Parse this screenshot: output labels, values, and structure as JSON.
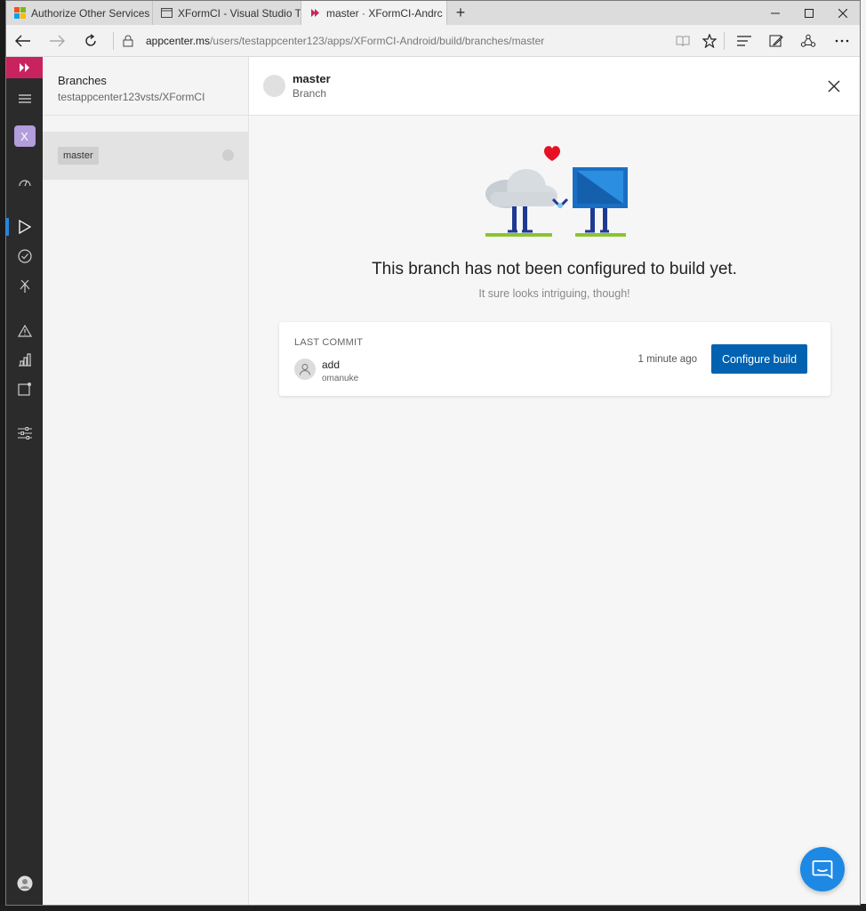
{
  "browser": {
    "tabs": [
      {
        "label": "Authorize Other Services | M",
        "icon": "microsoft-logo-icon"
      },
      {
        "label": "XFormCI - Visual Studio Tear",
        "icon": "page-icon"
      },
      {
        "label": "master · XFormCI-Andrc",
        "icon": "appcenter-logo-icon",
        "active": true
      }
    ],
    "new_tab": "+",
    "url_host": "appcenter.ms",
    "url_path": "/users/testappcenter123/apps/XFormCI-Android/build/branches/master"
  },
  "rail": {
    "app_initial": "X",
    "active_item": "build"
  },
  "branches_panel": {
    "title": "Branches",
    "subtitle": "testappcenter123vsts/XFormCI",
    "items": [
      {
        "label": "master"
      }
    ]
  },
  "branch_detail": {
    "title": "master",
    "subtitle": "Branch",
    "empty_title": "This branch has not been configured to build yet.",
    "empty_subtitle": "It sure looks intriguing, though!",
    "commit": {
      "section_label": "LAST COMMIT",
      "message": "add",
      "author": "omanuke",
      "time": "1 minute ago"
    },
    "configure_label": "Configure build"
  },
  "colors": {
    "brand": "#c8235e",
    "primary_button": "#0062b1",
    "chat": "#1e88e5"
  }
}
